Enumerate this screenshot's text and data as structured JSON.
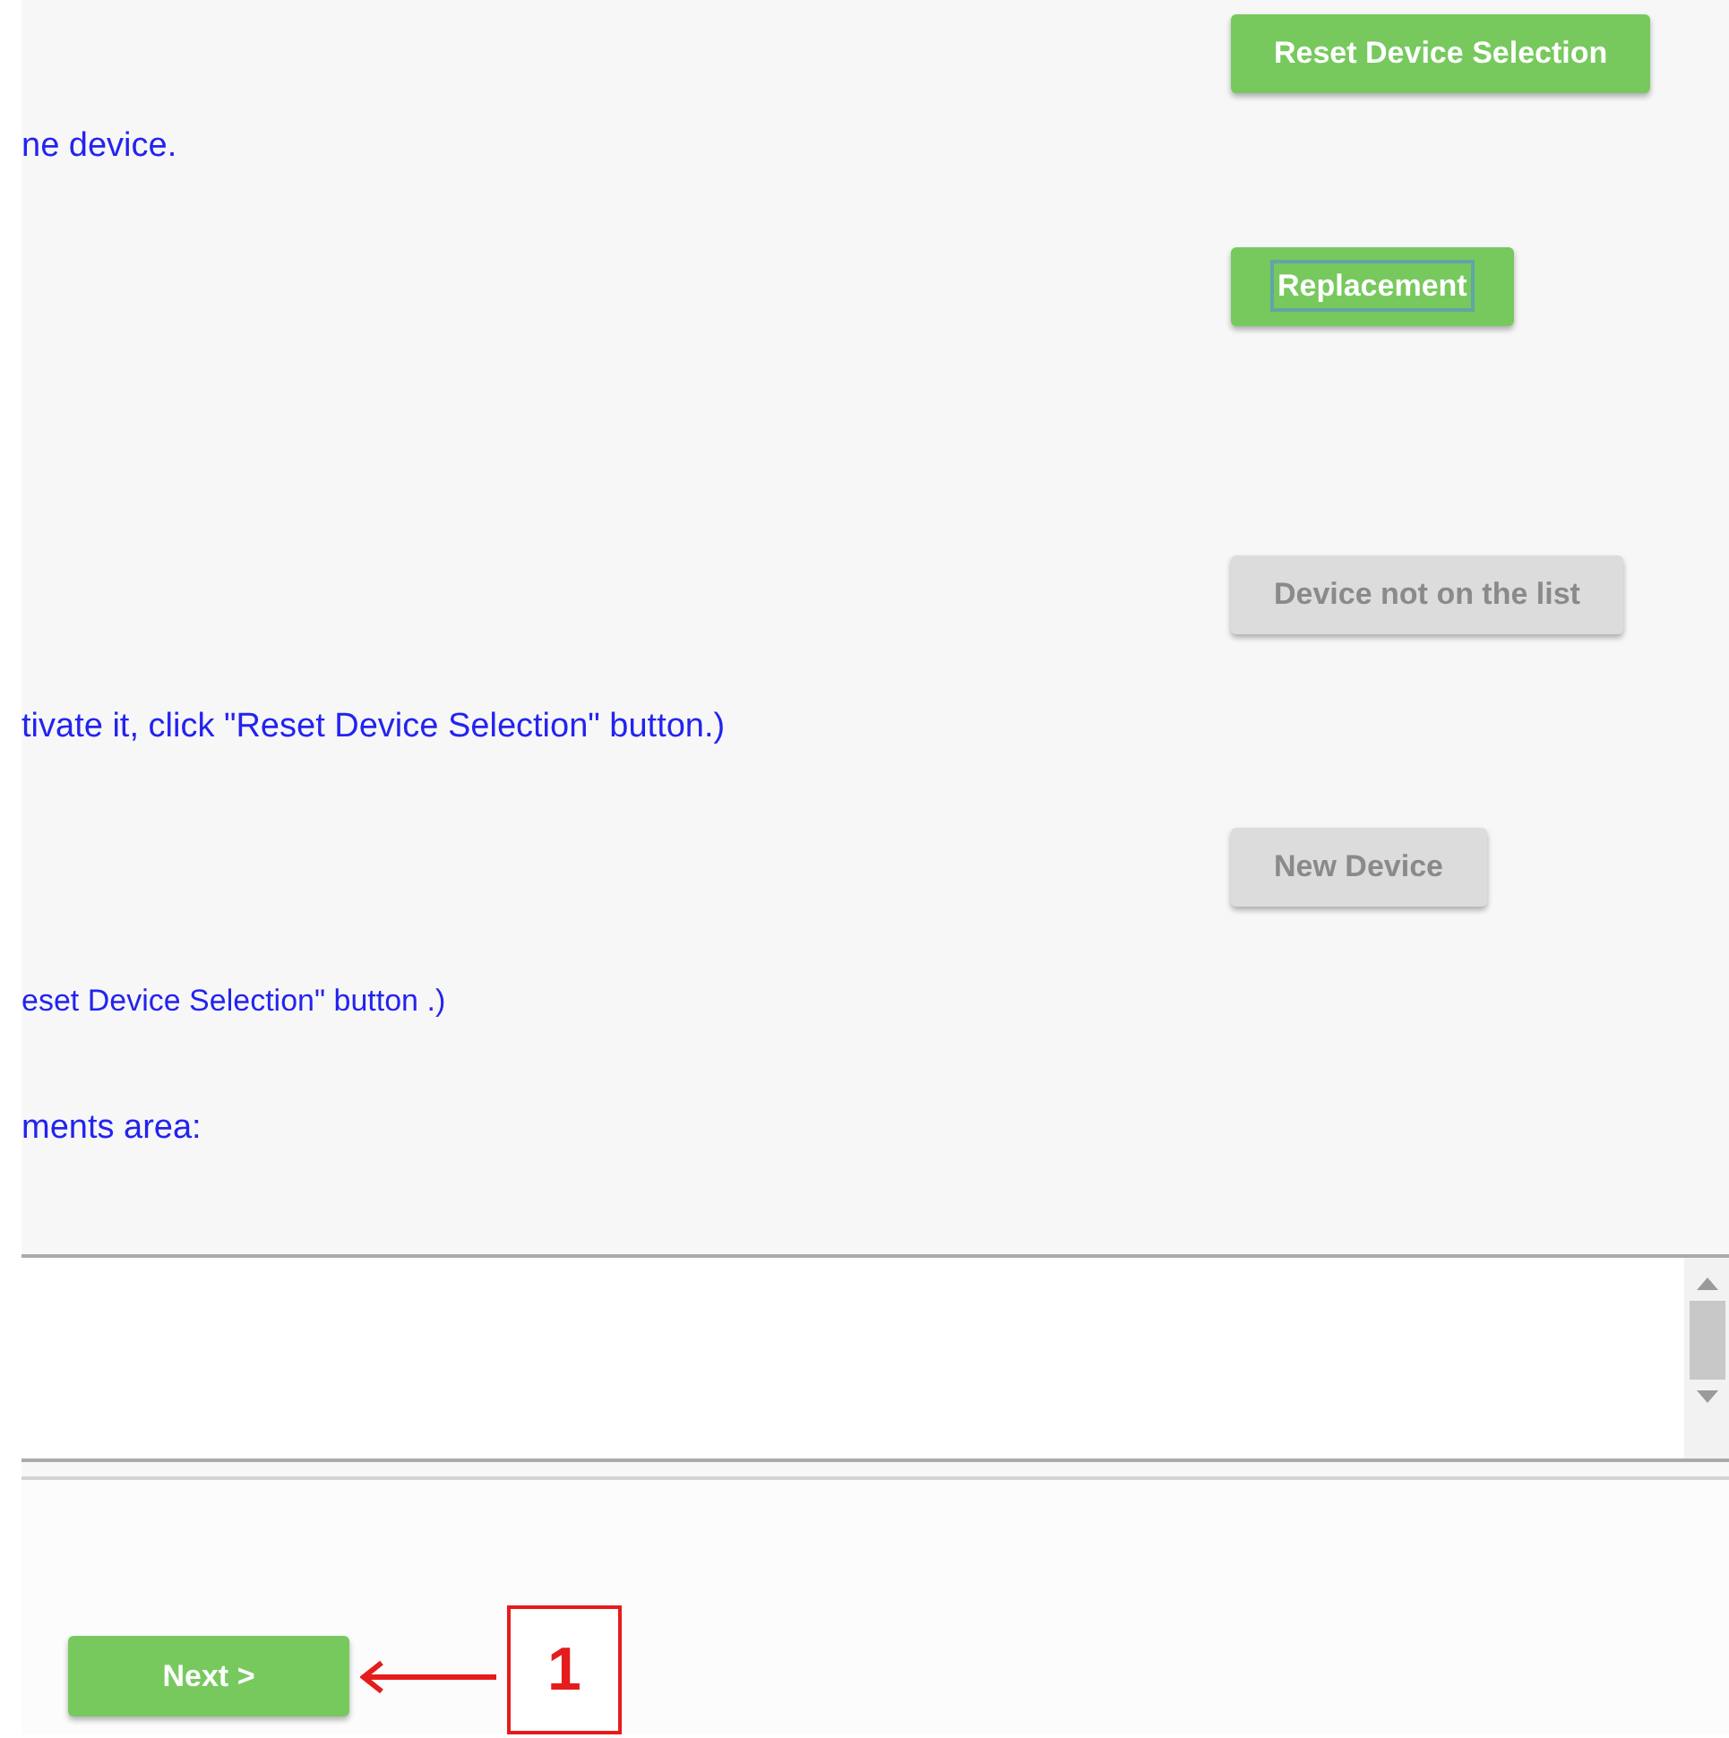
{
  "rows": [
    {
      "kind": "button",
      "label": "Reset Device Selection",
      "disabled": false,
      "focused": false
    },
    {
      "kind": "text",
      "text": "ne device."
    },
    {
      "kind": "button",
      "label": "Replacement",
      "disabled": false,
      "focused": true
    },
    {
      "kind": "button",
      "label": "Device not on the list",
      "disabled": true,
      "focused": false
    },
    {
      "kind": "text",
      "text": "tivate it, click \"Reset Device Selection\" button.)"
    },
    {
      "kind": "button",
      "label": "New Device",
      "disabled": true,
      "focused": false
    },
    {
      "kind": "note",
      "text": "eset Device Selection\" button .)"
    },
    {
      "kind": "text",
      "text": "ments area:"
    }
  ],
  "next_button": {
    "label": "Next >"
  },
  "callout": {
    "label": "1"
  }
}
